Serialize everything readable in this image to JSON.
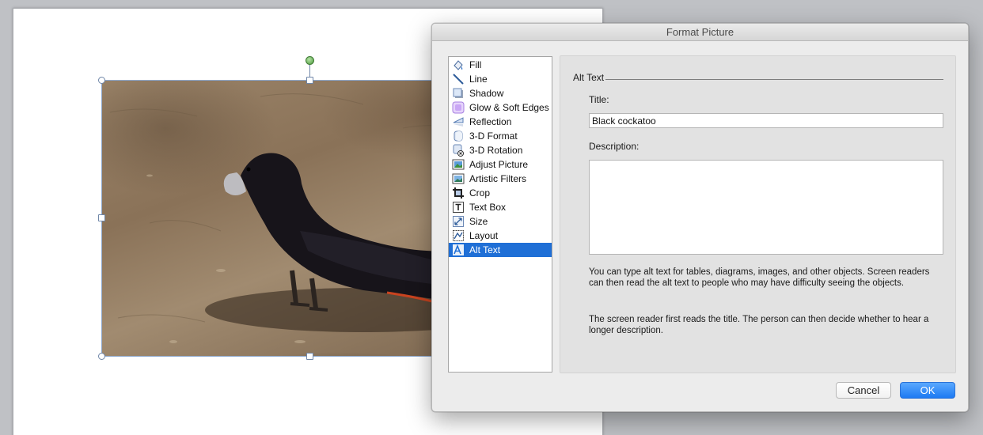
{
  "dialog": {
    "title": "Format Picture",
    "categories": [
      {
        "label": "Fill",
        "icon": "fill-icon"
      },
      {
        "label": "Line",
        "icon": "line-icon"
      },
      {
        "label": "Shadow",
        "icon": "shadow-icon"
      },
      {
        "label": "Glow & Soft Edges",
        "icon": "glow-icon"
      },
      {
        "label": "Reflection",
        "icon": "reflection-icon"
      },
      {
        "label": "3-D Format",
        "icon": "3d-format-icon"
      },
      {
        "label": "3-D Rotation",
        "icon": "3d-rotation-icon"
      },
      {
        "label": "Adjust Picture",
        "icon": "adjust-picture-icon"
      },
      {
        "label": "Artistic Filters",
        "icon": "artistic-filters-icon"
      },
      {
        "label": "Crop",
        "icon": "crop-icon"
      },
      {
        "label": "Text Box",
        "icon": "text-box-icon"
      },
      {
        "label": "Size",
        "icon": "size-icon"
      },
      {
        "label": "Layout",
        "icon": "layout-icon"
      },
      {
        "label": "Alt Text",
        "icon": "alt-text-icon"
      }
    ],
    "selected_category": "Alt Text",
    "accent_color": "#1f6fd6",
    "alt_text": {
      "section_title": "Alt Text",
      "title_label": "Title:",
      "title_value": "Black cockatoo",
      "description_label": "Description:",
      "description_value": "",
      "help_1": "You can type alt text for tables, diagrams, images, and other objects. Screen readers can then read the alt text to people who may have difficulty seeing the objects.",
      "help_2": "The screen reader first reads the title. The person can then decide whether to hear a longer description."
    },
    "buttons": {
      "cancel": "Cancel",
      "ok": "OK"
    }
  }
}
